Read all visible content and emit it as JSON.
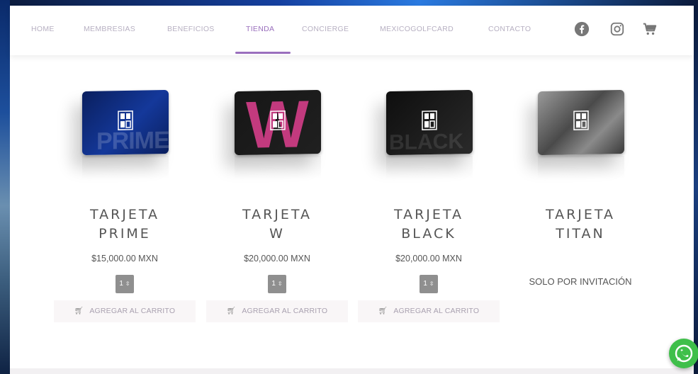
{
  "nav": {
    "items": [
      {
        "label": "HOME"
      },
      {
        "label": "MEMBRESIAS"
      },
      {
        "label": "BENEFICIOS"
      },
      {
        "label": "TIENDA"
      },
      {
        "label": "CONCIERGE"
      },
      {
        "label": "MEXICOGOLFCARD"
      },
      {
        "label": "CONTACTO"
      }
    ],
    "active": "TIENDA",
    "icons": [
      "facebook-icon",
      "instagram-icon",
      "cart-icon"
    ]
  },
  "products": [
    {
      "title_line1": "TARJETA",
      "title_line2": "PRIME",
      "card_word": "PRIME",
      "price": "$15,000.00 MXN",
      "qty": "1",
      "button": "AGREGAR AL CARRITO",
      "card_color": "#0d2a7a"
    },
    {
      "title_line1": "TARJETA",
      "title_line2": "W",
      "card_word": "W",
      "price": "$20,000.00 MXN",
      "qty": "1",
      "button": "AGREGAR AL CARRITO",
      "card_color": "#111111"
    },
    {
      "title_line1": "TARJETA",
      "title_line2": "BLACK",
      "card_word": "BLACK",
      "price": "$20,000.00 MXN",
      "qty": "1",
      "button": "AGREGAR AL CARRITO",
      "card_color": "#1a1a1a"
    },
    {
      "title_line1": "TARJETA",
      "title_line2": "TITAN",
      "note": "SOLO POR INVITACIÓN",
      "card_color": "#5a5a5a"
    }
  ],
  "colors": {
    "accent": "#9a6fbd",
    "whatsapp": "#3fbf4a"
  }
}
